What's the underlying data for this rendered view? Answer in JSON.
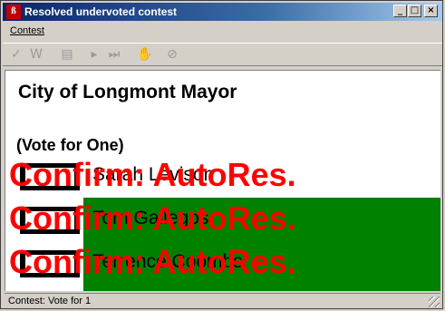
{
  "window": {
    "title": "Resolved undervoted contest",
    "app_icon_text": "ß",
    "controls": {
      "minimize": "_",
      "maximize": "□",
      "close": "×"
    }
  },
  "menu": {
    "items": [
      {
        "label": "Contest"
      }
    ]
  },
  "toolbar": {
    "buttons": [
      {
        "icon": "checkmark-icon",
        "glyph": "✓"
      },
      {
        "icon": "write-in-icon",
        "glyph": "W"
      },
      {
        "icon": "document-icon",
        "glyph": "▤"
      },
      {
        "icon": "next-icon",
        "glyph": "▸"
      },
      {
        "icon": "skip-icon",
        "glyph": "⏭"
      },
      {
        "icon": "hand-icon",
        "glyph": "✋"
      },
      {
        "icon": "cancel-icon",
        "glyph": "⊘"
      }
    ]
  },
  "contest": {
    "title": "City of Longmont Mayor",
    "vote_for": "(Vote for One)",
    "candidates": [
      {
        "name": "Sarah Levison"
      },
      {
        "name": "Tom Gallegos"
      },
      {
        "name": "Terrence Coombs"
      }
    ],
    "overlay_text": "Confirm: AutoRes."
  },
  "status": {
    "text": "Contest: Vote for 1"
  },
  "colors": {
    "title_bar": "#0a246a",
    "overlay": "#ff0000",
    "resolved_panel": "#008000"
  }
}
